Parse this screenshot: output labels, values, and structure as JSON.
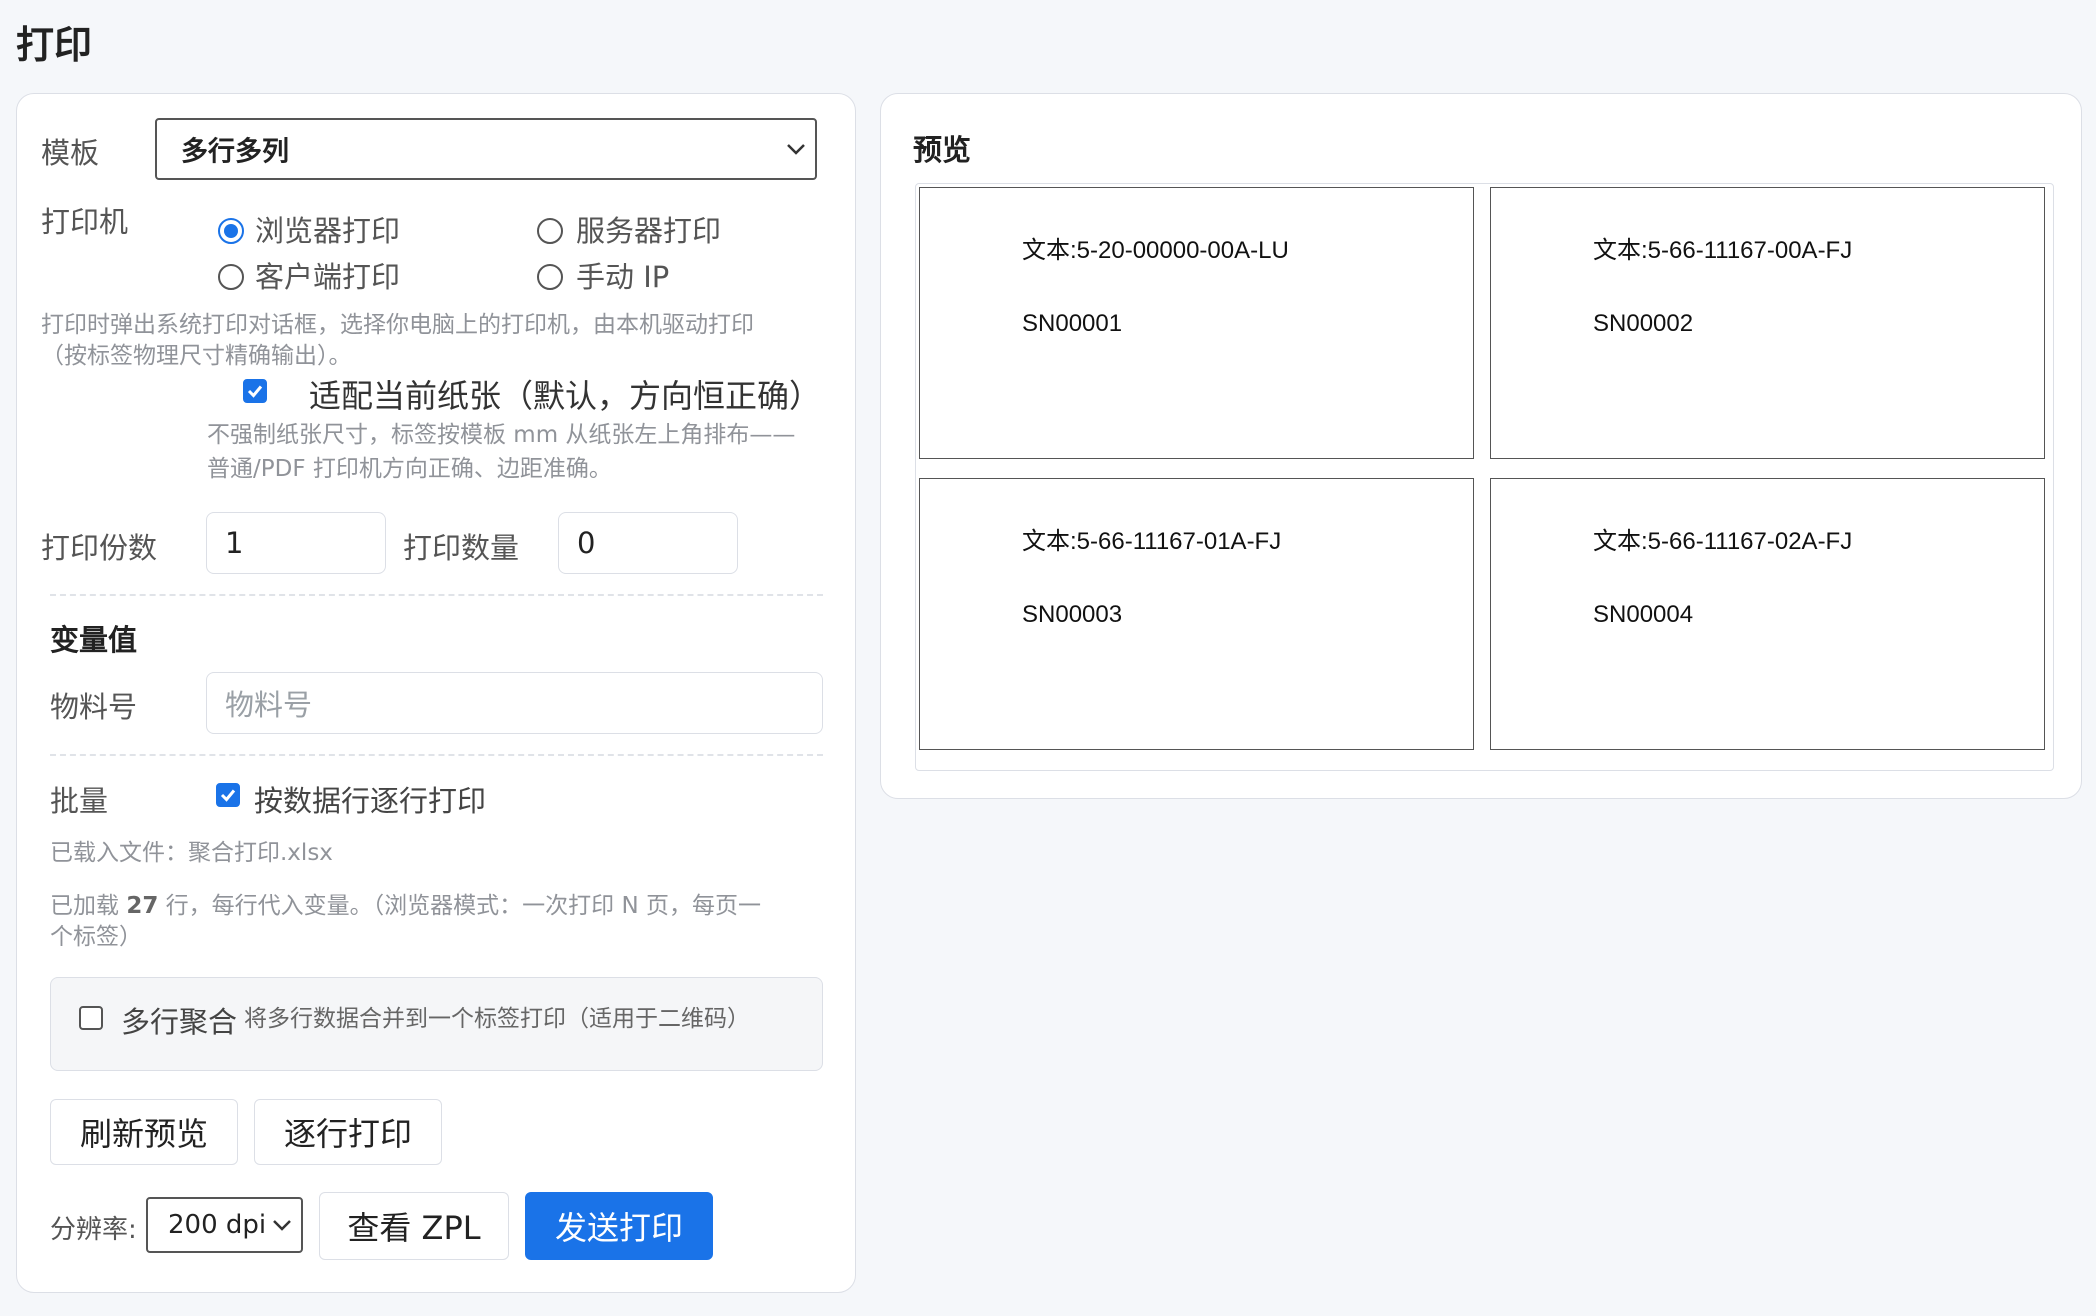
{
  "page_title": "打印",
  "form": {
    "template_label": "模板",
    "template_value": "多行多列",
    "printer_label": "打印机",
    "printer_options": [
      {
        "label": "浏览器打印",
        "selected": true
      },
      {
        "label": "服务器打印",
        "selected": false
      },
      {
        "label": "客户端打印",
        "selected": false
      },
      {
        "label": "手动 IP",
        "selected": false
      }
    ],
    "printer_hint_1": "打印时弹出系统打印对话框，选择你电脑上的打印机，由本机驱动打印",
    "printer_hint_2": "（按标签物理尺寸精确输出）。",
    "fit_paper_label": "适配当前纸张（默认，方向恒正确）",
    "fit_paper_checked": true,
    "fit_hint_1": "不强制纸张尺寸，标签按模板 mm 从纸张左上角排布——",
    "fit_hint_2": "普通/PDF 打印机方向正确、边距准确。",
    "copies_label": "打印份数",
    "copies_value": "1",
    "quantity_label": "打印数量",
    "quantity_value": "0",
    "variables_title": "变量值",
    "material_label": "物料号",
    "material_placeholder": "物料号",
    "batch_label": "批量",
    "batch_option_label": "按数据行逐行打印",
    "batch_checked": true,
    "loaded_file_text": "已载入文件：聚合打印.xlsx",
    "loaded_prefix": "已加载 ",
    "loaded_count": "27",
    "loaded_suffix": " 行，每行代入变量。（浏览器模式：一次打印 N 页，每页一",
    "loaded_suffix_2": "个标签）",
    "merge_label": "多行聚合",
    "merge_hint": "将多行数据合并到一个标签打印（适用于二维码）",
    "merge_checked": false,
    "refresh_button": "刷新预览",
    "line_print_button": "逐行打印",
    "dpi_label": "分辨率:",
    "dpi_value": "200 dpi",
    "view_zpl_button": "查看 ZPL",
    "send_print_button": "发送打印"
  },
  "preview": {
    "title": "预览",
    "labels": [
      {
        "text": "文本:5-20-00000-00A-LU",
        "sn": "SN00001"
      },
      {
        "text": "文本:5-66-11167-00A-FJ",
        "sn": "SN00002"
      },
      {
        "text": "文本:5-66-11167-01A-FJ",
        "sn": "SN00003"
      },
      {
        "text": "文本:5-66-11167-02A-FJ",
        "sn": "SN00004"
      }
    ]
  },
  "colors": {
    "accent": "#1a73e8",
    "background": "#f5f7fa",
    "hint_text": "#909399"
  },
  "icons": {
    "select_arrow": "chevron-down-icon",
    "checkbox_checked": "check-icon"
  }
}
